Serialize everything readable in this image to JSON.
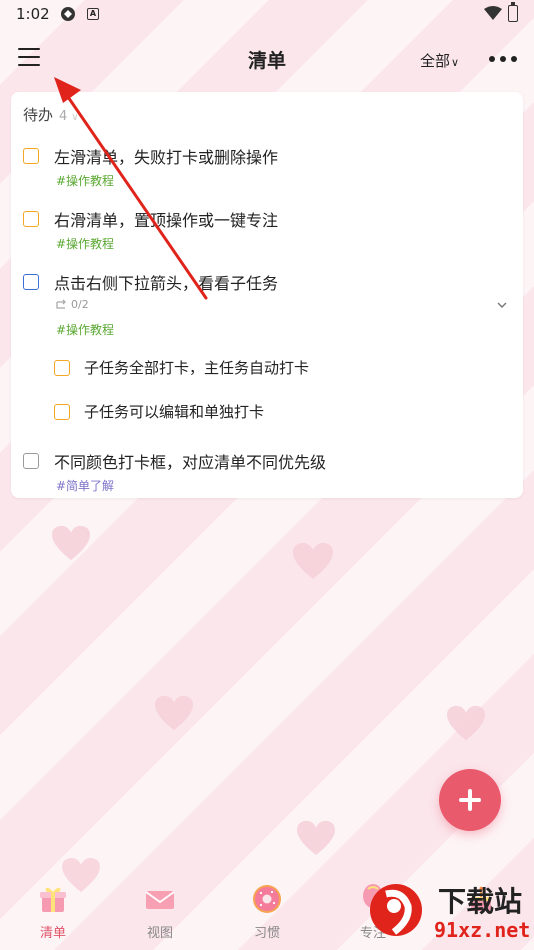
{
  "status_bar": {
    "time": "1:02",
    "badge": "A"
  },
  "header": {
    "title": "清单",
    "filter_label": "全部"
  },
  "section": {
    "label": "待办",
    "count": "4"
  },
  "tasks": [
    {
      "title": "左滑清单，失败打卡或删除操作",
      "tag": "#操作教程"
    },
    {
      "title": "右滑清单，置顶操作或一键专注",
      "tag": "#操作教程"
    },
    {
      "title": "点击右侧下拉箭头，看看子任务",
      "subtask_count": "0/2",
      "tag": "#操作教程",
      "subtasks": [
        {
          "title": "子任务全部打卡，主任务自动打卡"
        },
        {
          "title": "子任务可以编辑和单独打卡"
        }
      ]
    },
    {
      "title": "不同颜色打卡框，对应清单不同优先级",
      "tag": "#简单了解"
    }
  ],
  "bottom_nav": [
    {
      "label": "清单",
      "icon": "gift-icon",
      "active": true
    },
    {
      "label": "视图",
      "icon": "envelope-icon",
      "active": false
    },
    {
      "label": "习惯",
      "icon": "donut-icon",
      "active": false
    },
    {
      "label": "专注",
      "icon": "balloon-icon",
      "active": false
    },
    {
      "label": "",
      "icon": "cake-icon",
      "active": false
    }
  ],
  "watermark": {
    "logo_text": "下载站",
    "url": "91xz.net"
  },
  "colors": {
    "accent": "#ea5a6d",
    "priority_orange": "#f5a623",
    "priority_blue": "#3b6fd6",
    "priority_gray": "#9a9a9a",
    "tag_green": "#5aa832",
    "tag_purple": "#7c73c8",
    "annotation_red": "#e0241b"
  }
}
